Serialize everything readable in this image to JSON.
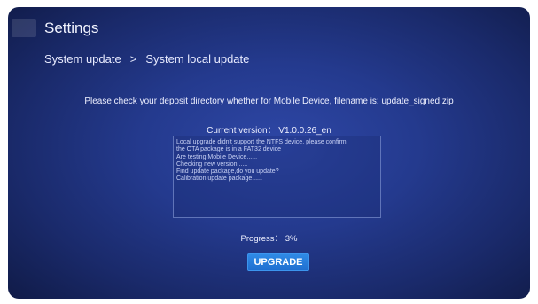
{
  "header": {
    "title": "Settings"
  },
  "breadcrumb": {
    "items": [
      "System update",
      "System local update"
    ],
    "separator": ">"
  },
  "main": {
    "instruction": "Please check your deposit directory whether for Mobile Device, filename is: update_signed.zip",
    "version_text": "Current version： V1.0.0.26_en",
    "log_lines": [
      "Local upgrade didn't support the NTFS device, please confirm",
      "the OTA package is in a FAT32 device",
      "Are testing Mobile Device......",
      "Checking new version......",
      "Find update package,do you update?",
      "Calibration update package......"
    ],
    "progress_text": "Progress： 3%",
    "progress_value": 0.03,
    "upgrade_label": "UPGRADE"
  },
  "colors": {
    "background": "#243a8e",
    "button": "#2a7fdd"
  }
}
